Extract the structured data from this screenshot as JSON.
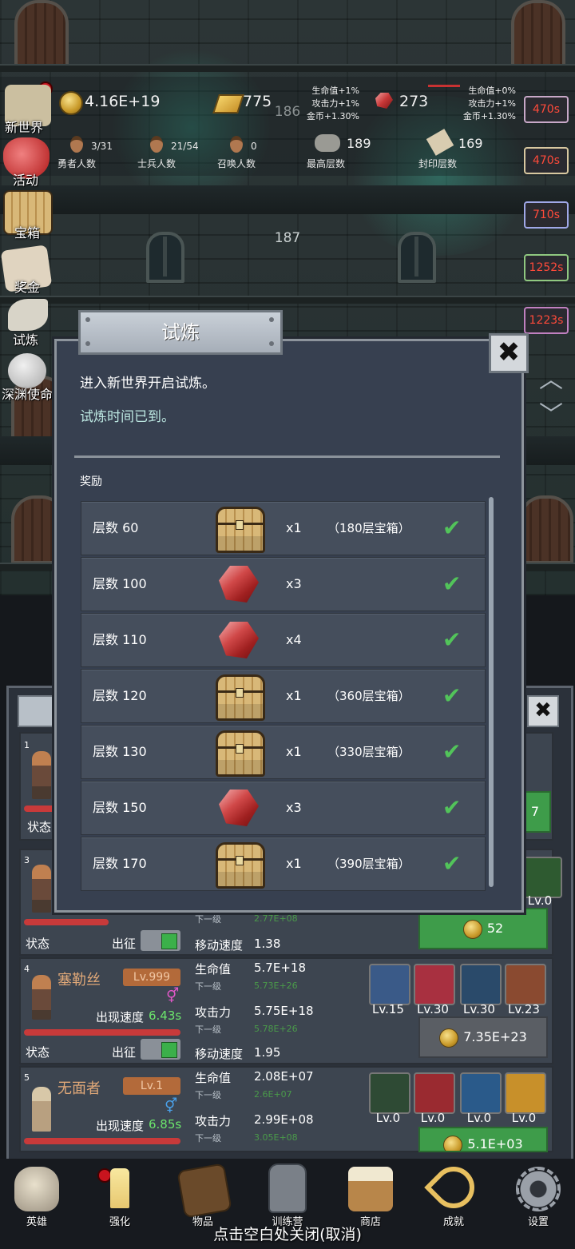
{
  "hud": {
    "gold": "4.16E+19",
    "ingot": "775",
    "ruby": "273",
    "bonus_left": [
      "生命值+1%",
      "攻击力+1%",
      "金币+1.30%"
    ],
    "bonus_right": [
      "生命值+0%",
      "攻击力+1%",
      "金币+1.30%"
    ],
    "hero_count": {
      "value": "3/31",
      "label": "勇者人数"
    },
    "soldier_count": {
      "value": "21/54",
      "label": "士兵人数"
    },
    "summon_count": {
      "value": "0",
      "label": "召唤人数"
    },
    "max_floor": {
      "value": "189",
      "label": "最高层数"
    },
    "seal_floor": {
      "value": "169",
      "label": "封印层数"
    }
  },
  "floors": [
    "186",
    "187"
  ],
  "side_menu": [
    "新世界",
    "活动",
    "宝箱",
    "奖金",
    "试炼",
    "深渊使命"
  ],
  "timers": [
    "470s",
    "470s",
    "710s",
    "1252s",
    "1223s"
  ],
  "modal": {
    "title": "试炼",
    "close_icon": "close-icon",
    "line1": "进入新世界开启试炼。",
    "line2": "试炼时间已到。",
    "reward_header": "奖励",
    "rewards": [
      {
        "label": "层数 60",
        "icon": "chest",
        "qty": "x1",
        "note": "（180层宝箱）"
      },
      {
        "label": "层数 100",
        "icon": "ruby",
        "qty": "x3",
        "note": ""
      },
      {
        "label": "层数 110",
        "icon": "ruby",
        "qty": "x4",
        "note": ""
      },
      {
        "label": "层数 120",
        "icon": "chest",
        "qty": "x1",
        "note": "（360层宝箱）"
      },
      {
        "label": "层数 130",
        "icon": "chest",
        "qty": "x1",
        "note": "（330层宝箱）"
      },
      {
        "label": "层数 150",
        "icon": "ruby",
        "qty": "x3",
        "note": ""
      },
      {
        "label": "层数 170",
        "icon": "chest",
        "qty": "x1",
        "note": "（390层宝箱）"
      }
    ]
  },
  "heroes": {
    "card1": {
      "num": "1",
      "status": "状态",
      "btn_tail": "7"
    },
    "card3": {
      "num": "3",
      "status": "状态",
      "deploy": "出征",
      "next_label": "下一级",
      "next_val": "2.77E+08",
      "move_label": "移动速度",
      "move_val": "1.38",
      "cost": "52",
      "skill_lv": "Lv.0"
    },
    "card4": {
      "num": "4",
      "name": "塞勒丝",
      "lv": "Lv.999",
      "appear_label": "出现速度",
      "appear_val": "6.43s",
      "status": "状态",
      "deploy": "出征",
      "hp_label": "生命值",
      "hp": "5.7E+18",
      "hp_next_label": "下一级",
      "hp_next": "5.73E+26",
      "atk_label": "攻击力",
      "atk": "5.75E+18",
      "atk_next_label": "下一级",
      "atk_next": "5.78E+26",
      "move_label": "移动速度",
      "move_val": "1.95",
      "skills": [
        "Lv.15",
        "Lv.30",
        "Lv.30",
        "Lv.23"
      ],
      "cost": "7.35E+23"
    },
    "card5": {
      "num": "5",
      "name": "无面者",
      "lv": "Lv.1",
      "appear_label": "出现速度",
      "appear_val": "6.85s",
      "hp_label": "生命值",
      "hp": "2.08E+07",
      "hp_next_label": "下一级",
      "hp_next": "2.6E+07",
      "atk_label": "攻击力",
      "atk": "2.99E+08",
      "atk_next_label": "下一级",
      "atk_next": "3.05E+08",
      "skills": [
        "Lv.0",
        "Lv.0",
        "Lv.0",
        "Lv.0"
      ],
      "cost": "5.1E+03"
    }
  },
  "nav": [
    "英雄",
    "强化",
    "物品",
    "训练营",
    "商店",
    "成就",
    "设置"
  ],
  "hint": "点击空白处关闭(取消)",
  "colors": {
    "accent_green": "#3e9c4a",
    "timer_red": "#ff4a3a",
    "level_orange": "#b36a3a"
  }
}
